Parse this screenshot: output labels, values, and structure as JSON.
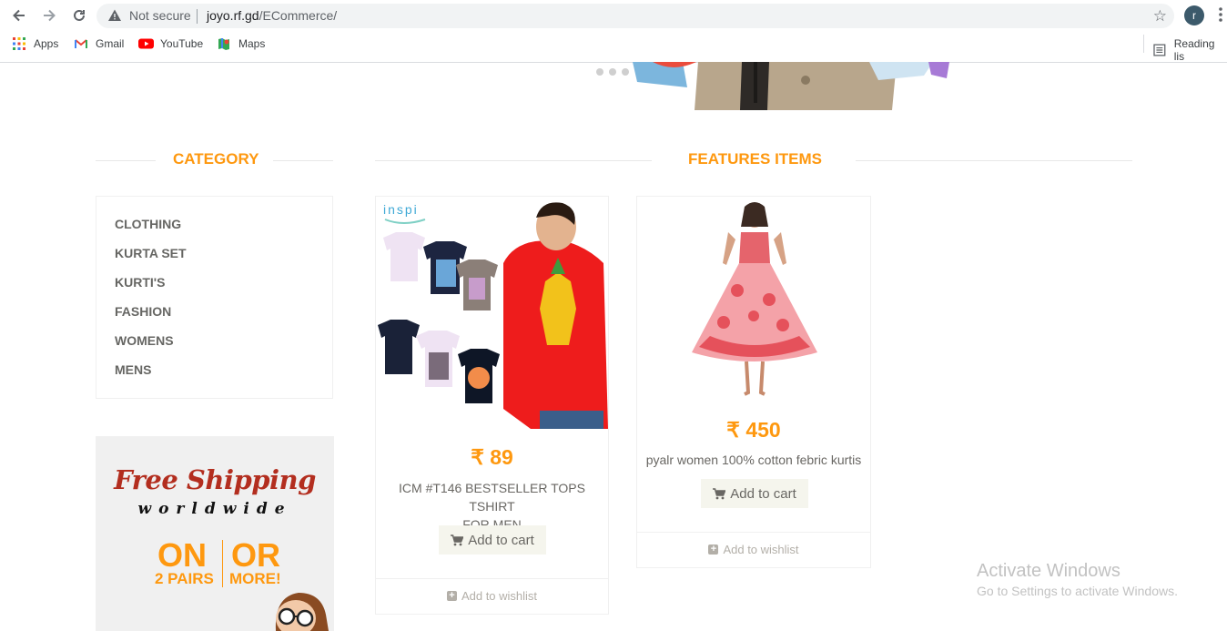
{
  "browser": {
    "not_secure_label": "Not secure",
    "url_host": "joyo.rf.gd",
    "url_path": "/ECommerce/",
    "profile_initial": "r",
    "bookmarks": [
      {
        "label": "Apps"
      },
      {
        "label": "Gmail"
      },
      {
        "label": "YouTube"
      },
      {
        "label": "Maps"
      }
    ],
    "reading_list_label": "Reading lis"
  },
  "sidebar": {
    "category_title": "CATEGORY",
    "categories": [
      "CLOTHING",
      "KURTA SET",
      "KURTI'S",
      "FASHION",
      "WOMENS",
      "MENS"
    ],
    "promo": {
      "free_shipping": "Free Shipping",
      "worldwide": "worldwide",
      "on": "ON",
      "or": "OR",
      "pairs": "2 PAIRS",
      "more": "MORE!"
    }
  },
  "features": {
    "title": "FEATURES ITEMS",
    "products": [
      {
        "price": "₹ 89",
        "name_line1": "ICM #T146 BESTSELLER TOPS TSHIRT",
        "name_line2": "FOR MEN",
        "add_to_cart": "Add to cart",
        "add_to_wishlist": "Add to wishlist",
        "image_brand": "inspi"
      },
      {
        "price": "₹ 450",
        "name_line1": "pyalr women 100% cotton febric kurtis",
        "add_to_cart": "Add to cart",
        "add_to_wishlist": "Add to wishlist"
      }
    ]
  },
  "os_overlay": {
    "title": "Activate Windows",
    "subtitle": "Go to Settings to activate Windows."
  },
  "colors": {
    "accent": "#fe980f",
    "muted_text": "#696763",
    "promo_red": "#b32e1f"
  }
}
